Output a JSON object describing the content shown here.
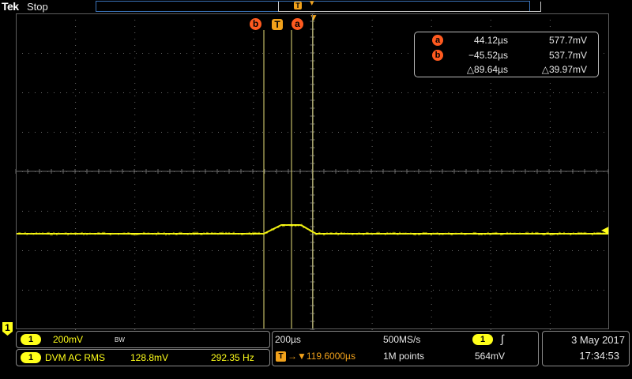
{
  "header": {
    "brand": "Tek",
    "run_state": "Stop",
    "record_trigger_icon": "T",
    "record_position_icon": "▾",
    "hpos_icon": "▼"
  },
  "cursors": {
    "a_label": "a",
    "b_label": "b",
    "trigger_label": "T",
    "readout": {
      "a_time": "44.12µs",
      "a_volt": "577.7mV",
      "b_time": "−45.52µs",
      "b_volt": "537.7mV",
      "delta_time": "△89.64µs",
      "delta_volt": "△39.97mV"
    }
  },
  "channel1": {
    "label": "1",
    "color": "#ffff1a",
    "scale": "200mV",
    "bandwidth_icon": "BW",
    "level_marker": "◀"
  },
  "dvm": {
    "label": "1",
    "mode": "DVM AC RMS",
    "value": "128.8mV",
    "frequency": "292.35 Hz"
  },
  "timebase": {
    "scale": "200µs",
    "sample_rate": "500MS/s",
    "trigger_icon": "T",
    "delay": "→▼119.6000µs",
    "record_length": "1M points"
  },
  "trigger": {
    "source": "1",
    "slope_icon": "rising-edge",
    "slope_glyph": "∫",
    "level": "564mV"
  },
  "datetime": {
    "date": "3 May 2017",
    "time": "17:34:53"
  },
  "colors": {
    "ch1": "#ffff1a",
    "cursor_ab": "#ff5a1f",
    "trigger": "#f2a21b",
    "record_bar": "#3b73b9"
  }
}
